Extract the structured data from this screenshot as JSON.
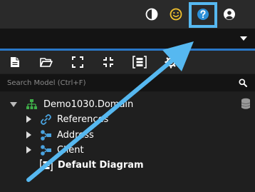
{
  "header": {
    "icons": [
      "contrast-icon",
      "feedback-smiley-icon",
      "help-icon",
      "user-account-icon"
    ]
  },
  "search": {
    "placeholder": "Search Model (Ctrl+F)"
  },
  "toolbar": {
    "icons": [
      "new-document-icon",
      "open-folder-icon",
      "expand-icon",
      "collapse-icon",
      "diagram-icon",
      "settings-icon"
    ]
  },
  "tree": {
    "root": "Demo1030.Domain",
    "items": [
      "References",
      "Address",
      "Client",
      "Default Diagram"
    ]
  },
  "colors": {
    "highlight": "#56b8f0",
    "accent_blue": "#2a78c8",
    "smiley": "#f2c22e",
    "root_icon": "#3fae49"
  }
}
